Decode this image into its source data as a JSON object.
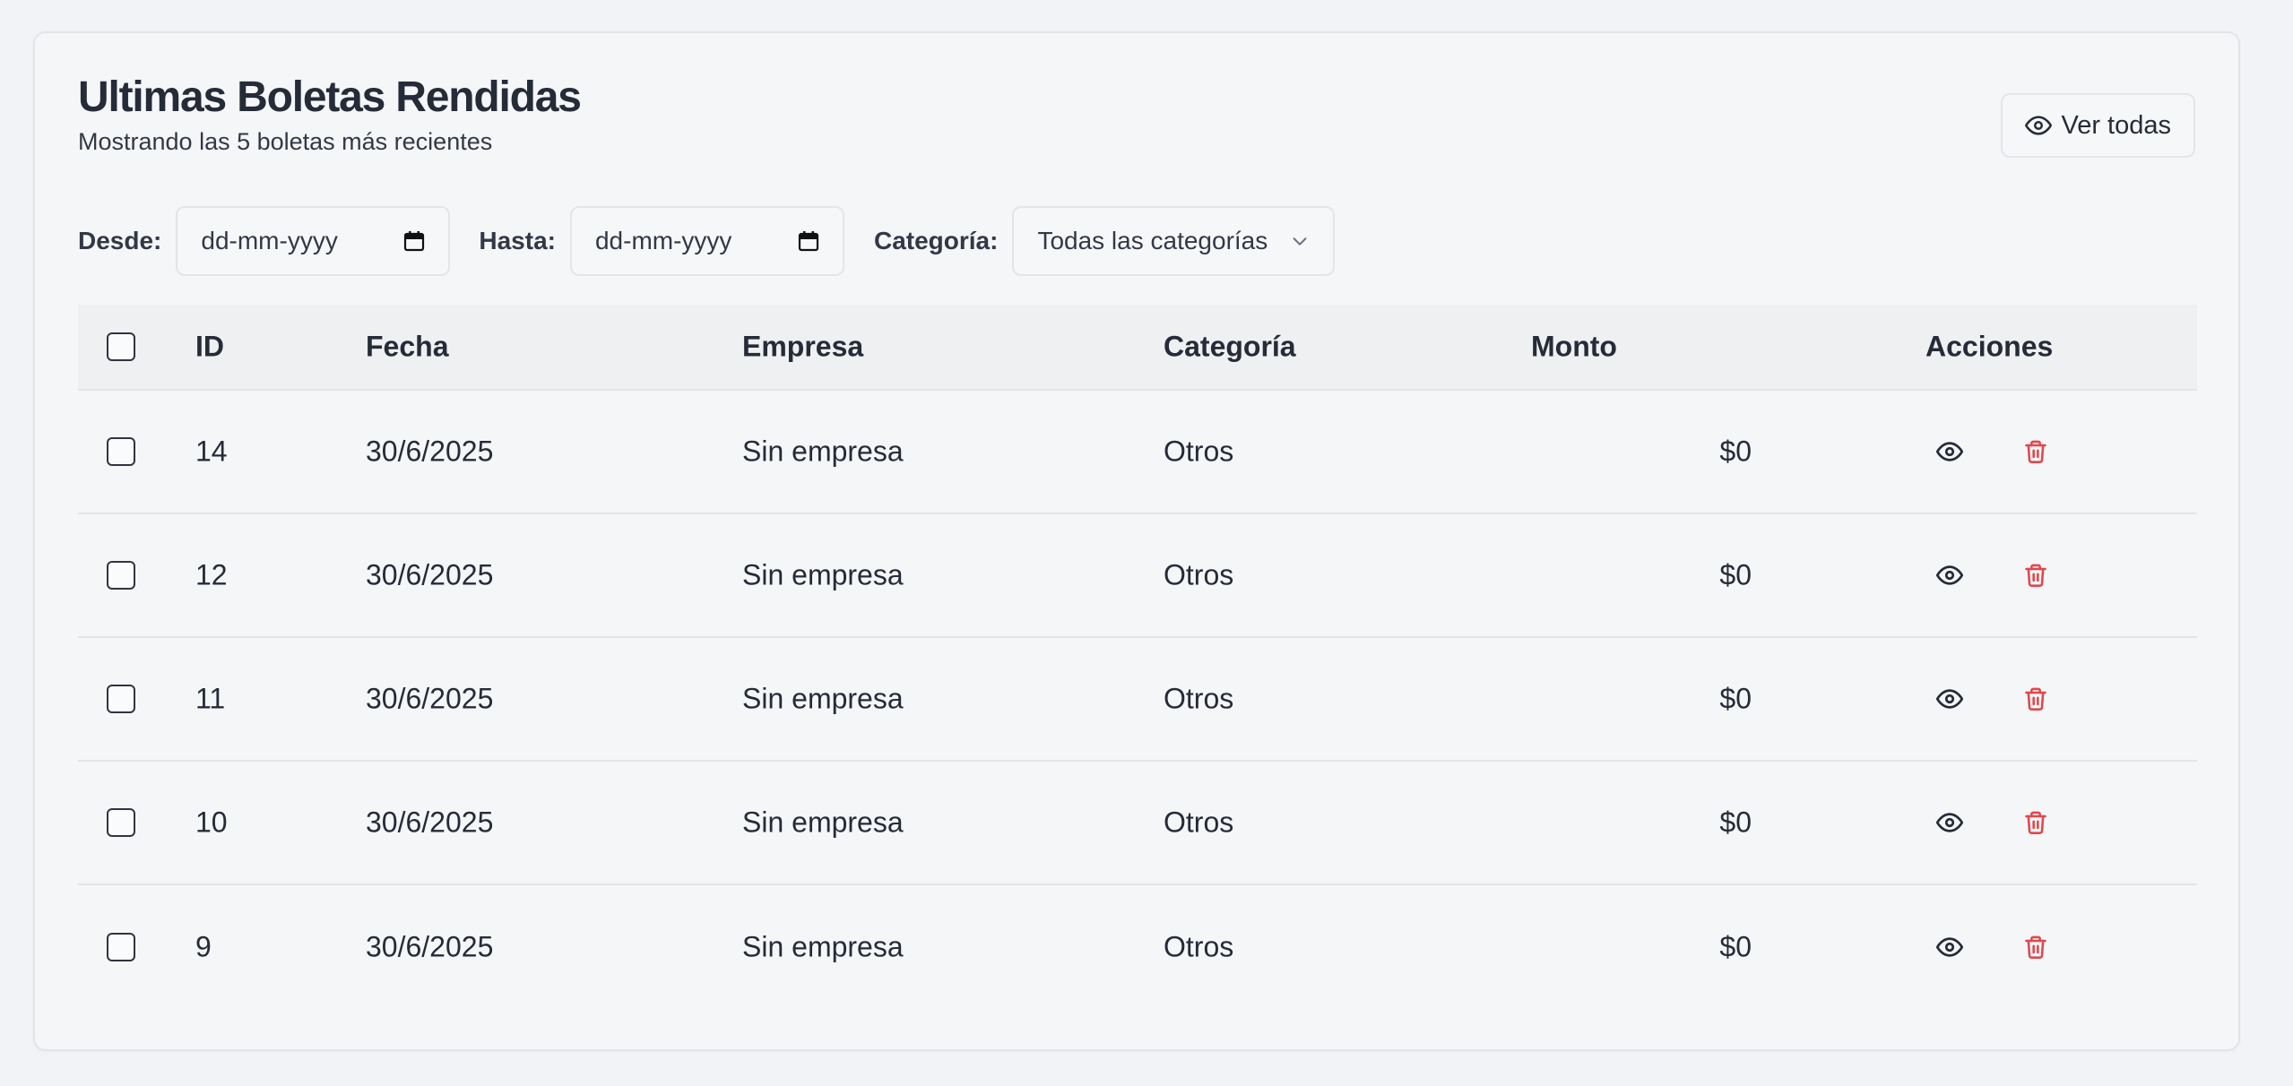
{
  "header": {
    "title": "Ultimas Boletas Rendidas",
    "subtitle": "Mostrando las 5 boletas más recientes",
    "view_all_label": "Ver todas",
    "view_all_icon": "eye-icon"
  },
  "filters": {
    "from_label": "Desde:",
    "from_value": "dd-mm-yyyy",
    "to_label": "Hasta:",
    "to_value": "dd-mm-yyyy",
    "category_label": "Categoría:",
    "category_value": "Todas las categorías",
    "date_icon": "calendar-icon",
    "select_icon": "chevron-down-icon"
  },
  "table": {
    "columns": [
      "ID",
      "Fecha",
      "Empresa",
      "Categoría",
      "Monto",
      "Acciones"
    ],
    "rows": [
      {
        "id": "14",
        "fecha": "30/6/2025",
        "empresa": "Sin empresa",
        "categoria": "Otros",
        "monto": "$0"
      },
      {
        "id": "12",
        "fecha": "30/6/2025",
        "empresa": "Sin empresa",
        "categoria": "Otros",
        "monto": "$0"
      },
      {
        "id": "11",
        "fecha": "30/6/2025",
        "empresa": "Sin empresa",
        "categoria": "Otros",
        "monto": "$0"
      },
      {
        "id": "10",
        "fecha": "30/6/2025",
        "empresa": "Sin empresa",
        "categoria": "Otros",
        "monto": "$0"
      },
      {
        "id": "9",
        "fecha": "30/6/2025",
        "empresa": "Sin empresa",
        "categoria": "Otros",
        "monto": "$0"
      }
    ],
    "action_icons": [
      "eye-icon",
      "trash-icon"
    ]
  },
  "colors": {
    "text": "#262b38",
    "delete": "#e0484c",
    "background": "#f2f3f6",
    "border": "#e2e4e9"
  }
}
